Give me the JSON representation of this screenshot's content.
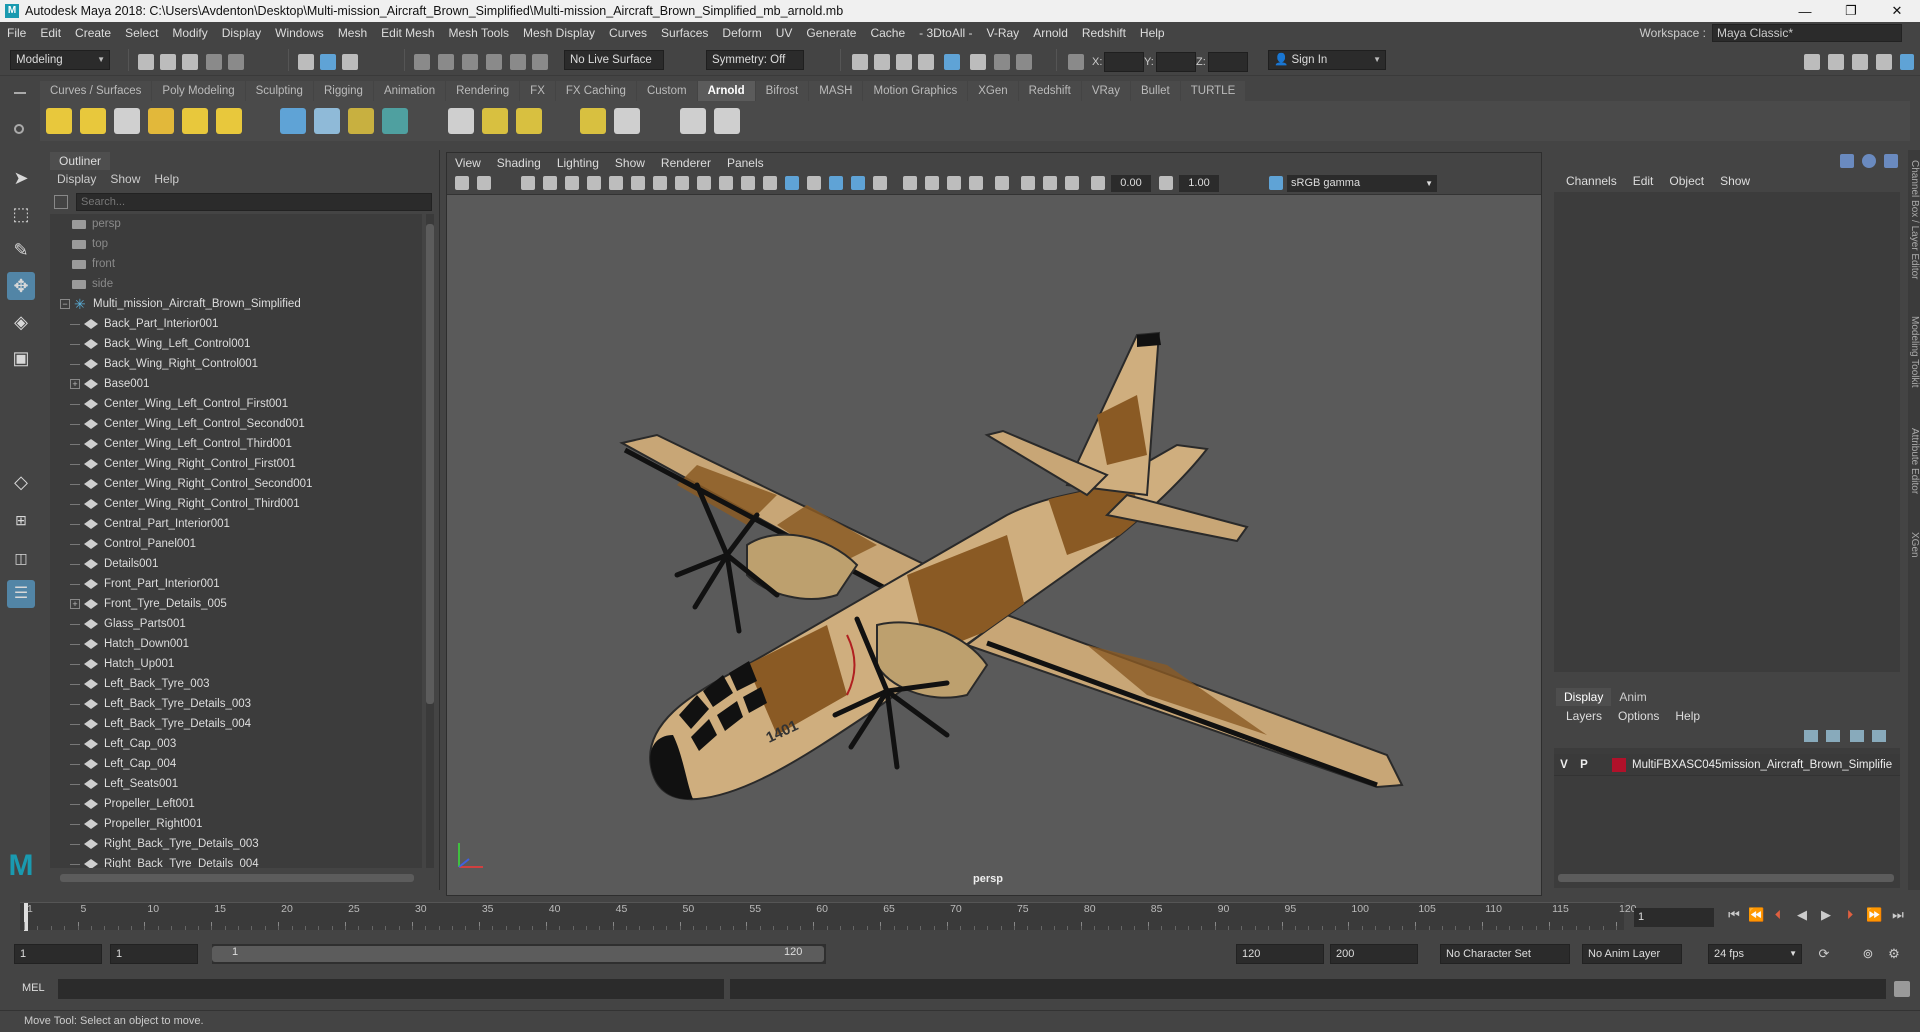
{
  "window": {
    "title": "Autodesk Maya 2018: C:\\Users\\Avdenton\\Desktop\\Multi-mission_Aircraft_Brown_Simplified\\Multi-mission_Aircraft_Brown_Simplified_mb_arnold.mb",
    "minimize": "—",
    "maximize": "❐",
    "close": "✕"
  },
  "menubar": {
    "items": [
      "File",
      "Edit",
      "Create",
      "Select",
      "Modify",
      "Display",
      "Windows",
      "Mesh",
      "Edit Mesh",
      "Mesh Tools",
      "Mesh Display",
      "Curves",
      "Surfaces",
      "Deform",
      "UV",
      "Generate",
      "Cache",
      "- 3DtoAll -",
      "V-Ray",
      "Arnold",
      "Redshift",
      "Help"
    ],
    "workspace_label": "Workspace :",
    "workspace_value": "Maya Classic*"
  },
  "statusline": {
    "menuset": "Modeling",
    "live_surface": "No Live Surface",
    "symmetry": "Symmetry: Off",
    "x_label": "X:",
    "y_label": "Y:",
    "z_label": "Z:",
    "sign_in": "Sign In"
  },
  "shelf": {
    "tabs": [
      "Curves / Surfaces",
      "Poly Modeling",
      "Sculpting",
      "Rigging",
      "Animation",
      "Rendering",
      "FX",
      "FX Caching",
      "Custom",
      "Arnold",
      "Bifrost",
      "MASH",
      "Motion Graphics",
      "XGen",
      "Redshift",
      "VRay",
      "Bullet",
      "TURTLE"
    ],
    "active_tab": "Arnold"
  },
  "outliner": {
    "tab": "Outliner",
    "menu": [
      "Display",
      "Show",
      "Help"
    ],
    "search_placeholder": "Search...",
    "cameras": [
      "persp",
      "top",
      "front",
      "side"
    ],
    "group": "Multi_mission_Aircraft_Brown_Simplified",
    "items": [
      {
        "name": "Back_Part_Interior001",
        "expandable": false
      },
      {
        "name": "Back_Wing_Left_Control001",
        "expandable": false
      },
      {
        "name": "Back_Wing_Right_Control001",
        "expandable": false
      },
      {
        "name": "Base001",
        "expandable": true
      },
      {
        "name": "Center_Wing_Left_Control_First001",
        "expandable": false
      },
      {
        "name": "Center_Wing_Left_Control_Second001",
        "expandable": false
      },
      {
        "name": "Center_Wing_Left_Control_Third001",
        "expandable": false
      },
      {
        "name": "Center_Wing_Right_Control_First001",
        "expandable": false
      },
      {
        "name": "Center_Wing_Right_Control_Second001",
        "expandable": false
      },
      {
        "name": "Center_Wing_Right_Control_Third001",
        "expandable": false
      },
      {
        "name": "Central_Part_Interior001",
        "expandable": false
      },
      {
        "name": "Control_Panel001",
        "expandable": false
      },
      {
        "name": "Details001",
        "expandable": false
      },
      {
        "name": "Front_Part_Interior001",
        "expandable": false
      },
      {
        "name": "Front_Tyre_Details_005",
        "expandable": true
      },
      {
        "name": "Glass_Parts001",
        "expandable": false
      },
      {
        "name": "Hatch_Down001",
        "expandable": false
      },
      {
        "name": "Hatch_Up001",
        "expandable": false
      },
      {
        "name": "Left_Back_Tyre_003",
        "expandable": false
      },
      {
        "name": "Left_Back_Tyre_Details_003",
        "expandable": false
      },
      {
        "name": "Left_Back_Tyre_Details_004",
        "expandable": false
      },
      {
        "name": "Left_Cap_003",
        "expandable": false
      },
      {
        "name": "Left_Cap_004",
        "expandable": false
      },
      {
        "name": "Left_Seats001",
        "expandable": false
      },
      {
        "name": "Propeller_Left001",
        "expandable": false
      },
      {
        "name": "Propeller_Right001",
        "expandable": false
      },
      {
        "name": "Right_Back_Tyre_Details_003",
        "expandable": false
      },
      {
        "name": "Right_Back_Tyre_Details_004",
        "expandable": false
      }
    ]
  },
  "viewport": {
    "menu": [
      "View",
      "Shading",
      "Lighting",
      "Show",
      "Renderer",
      "Panels"
    ],
    "exposure": "0.00",
    "gamma": "1.00",
    "colorspace": "sRGB gamma",
    "camera_label": "persp",
    "aircraft_tail_number": "1401"
  },
  "channelbox": {
    "menu": [
      "Channels",
      "Edit",
      "Object",
      "Show"
    ],
    "display_tabs": [
      "Display",
      "Anim"
    ],
    "active_display_tab": "Display",
    "layer_menu": [
      "Layers",
      "Options",
      "Help"
    ],
    "layer": {
      "v": "V",
      "p": "P",
      "name": "MultiFBXASC045mission_Aircraft_Brown_Simplifie",
      "color": "#b0112a"
    }
  },
  "sidetabs": [
    "Channel Box / Layer Editor",
    "Modeling Toolkit",
    "Attribute Editor",
    "XGen"
  ],
  "timeslider": {
    "ticks": [
      "1",
      "5",
      "10",
      "15",
      "20",
      "25",
      "30",
      "35",
      "40",
      "45",
      "50",
      "55",
      "60",
      "65",
      "70",
      "75",
      "80",
      "85",
      "90",
      "95",
      "100",
      "105",
      "110",
      "115",
      "120"
    ],
    "current_frame": "1"
  },
  "range": {
    "start": "1",
    "playback_start": "1",
    "slider_start": "1",
    "slider_end": "120",
    "playback_end": "120",
    "end": "200",
    "character_set": "No Character Set",
    "anim_layer": "No Anim Layer",
    "fps": "24 fps"
  },
  "cmdline": {
    "label": "MEL"
  },
  "helpline": {
    "text": "Move Tool: Select an object to move."
  }
}
